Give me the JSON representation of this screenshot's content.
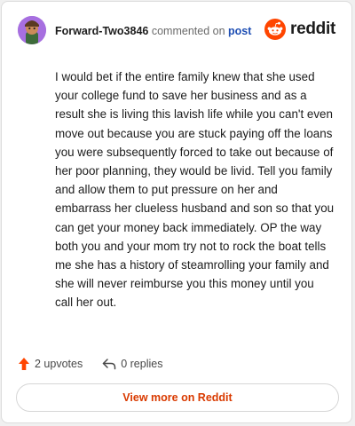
{
  "comment": {
    "username": "Forward-Two3846",
    "action_text": "commented on",
    "target_text": "post",
    "brand": "reddit",
    "body": "I would bet if the entire family knew that she used your college fund to save her business and as a result she is living this lavish life while you can't even move out because you are stuck paying off the loans you were subsequently forced to take out because of her poor planning, they would be livid. Tell you family and allow them to put pressure on her and embarrass her clueless husband and son so that you can get your money back immediately. OP the way both you and your mom try not to rock the boat tells me she has a history of steamrolling your family and she will never reimburse you this money until you call her out."
  },
  "actions": {
    "upvotes": "2 upvotes",
    "replies": "0 replies"
  },
  "footer": {
    "view_more": "View more on Reddit"
  },
  "colors": {
    "accent": "#ff4500",
    "link": "#1f4fb4",
    "button_text": "#d93a00"
  },
  "icons": {
    "upvote": "upvote-arrow-icon",
    "reply": "reply-arrow-icon",
    "logo": "reddit-snoo-icon"
  }
}
